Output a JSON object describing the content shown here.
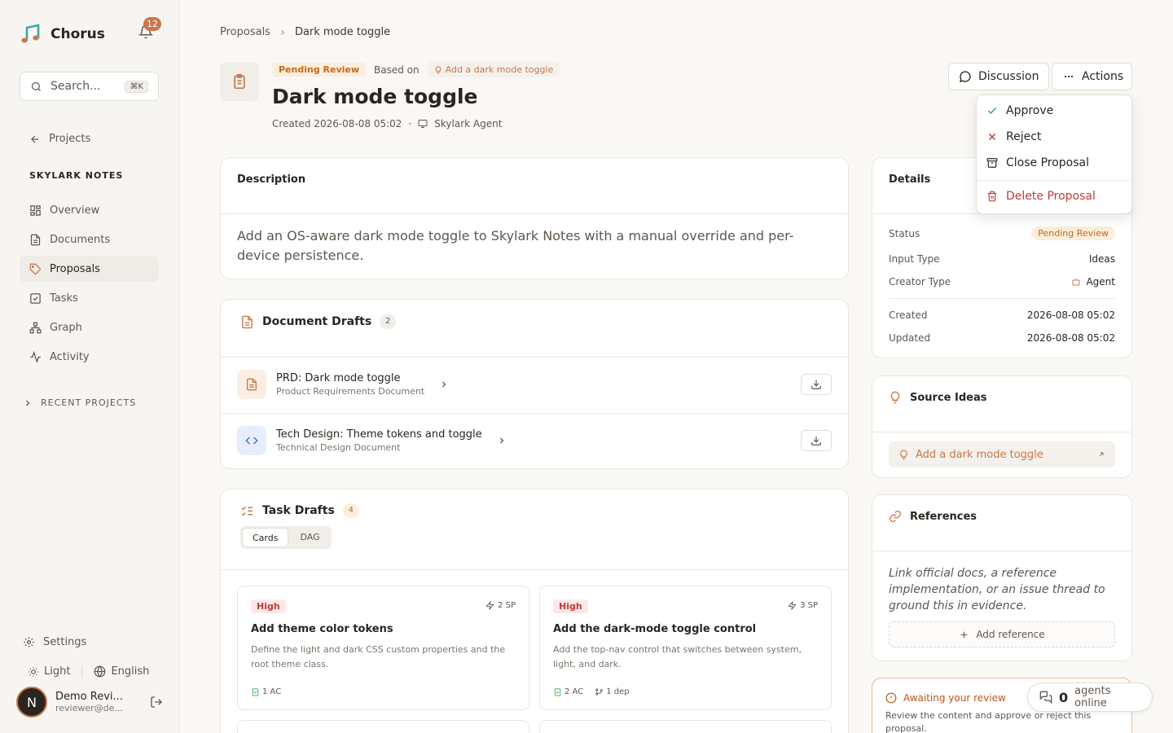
{
  "app": {
    "name": "Chorus",
    "notification_count": "12"
  },
  "search": {
    "placeholder": "Search...",
    "shortcut": "⌘K"
  },
  "sidebar": {
    "back_label": "Projects",
    "project_name": "SKYLARK NOTES",
    "items": [
      {
        "label": "Overview",
        "icon": "grid-icon"
      },
      {
        "label": "Documents",
        "icon": "document-icon"
      },
      {
        "label": "Proposals",
        "icon": "tag-icon",
        "active": true
      },
      {
        "label": "Tasks",
        "icon": "checkbox-icon"
      },
      {
        "label": "Graph",
        "icon": "graph-icon"
      },
      {
        "label": "Activity",
        "icon": "activity-icon"
      }
    ],
    "recent_label": "RECENT PROJECTS",
    "settings_label": "Settings",
    "theme_label": "Light",
    "language_label": "English",
    "user": {
      "initial": "N",
      "name": "Demo Revi...",
      "email": "reviewer@de..."
    }
  },
  "breadcrumb": {
    "parent": "Proposals",
    "current": "Dark mode toggle"
  },
  "proposal": {
    "status": "Pending Review",
    "based_on_label": "Based on",
    "idea_chip": "Add a dark mode toggle",
    "title": "Dark mode toggle",
    "created": "Created 2026-08-08 05:02",
    "agent": "Skylark Agent"
  },
  "buttons": {
    "discussion": "Discussion",
    "actions": "Actions"
  },
  "actions_menu": {
    "approve": "Approve",
    "reject": "Reject",
    "close": "Close Proposal",
    "delete": "Delete Proposal"
  },
  "description": {
    "title": "Description",
    "text": "Add an OS-aware dark mode toggle to Skylark Notes with a manual override and per-device persistence."
  },
  "document_drafts": {
    "title": "Document Drafts",
    "count": "2",
    "items": [
      {
        "title": "PRD: Dark mode toggle",
        "subtitle": "Product Requirements Document"
      },
      {
        "title": "Tech Design: Theme tokens and toggle",
        "subtitle": "Technical Design Document"
      }
    ]
  },
  "task_drafts": {
    "title": "Task Drafts",
    "count": "4",
    "tabs": [
      "Cards",
      "DAG"
    ],
    "cards": [
      {
        "priority": "High",
        "sp": "2 SP",
        "title": "Add theme color tokens",
        "desc": "Define the light and dark CSS custom properties and the root theme class.",
        "ac": "1 AC",
        "dep": ""
      },
      {
        "priority": "High",
        "sp": "3 SP",
        "title": "Add the dark-mode toggle control",
        "desc": "Add the top-nav control that switches between system, light, and dark.",
        "ac": "2 AC",
        "dep": "1 dep"
      }
    ]
  },
  "details": {
    "title": "Details",
    "status_label": "Status",
    "status_value": "Pending Review",
    "input_type_label": "Input Type",
    "input_type_value": "Ideas",
    "creator_type_label": "Creator Type",
    "creator_type_value": "Agent",
    "created_label": "Created",
    "created_value": "2026-08-08 05:02",
    "updated_label": "Updated",
    "updated_value": "2026-08-08 05:02"
  },
  "source_ideas": {
    "title": "Source Ideas",
    "item": "Add a dark mode toggle"
  },
  "references": {
    "title": "References",
    "empty_text": "Link official docs, a reference implementation, or an issue thread to ground this in evidence.",
    "add_label": "Add reference"
  },
  "awaiting": {
    "title": "Awaiting your review",
    "text": "Review the content and approve or reject this proposal."
  },
  "online": {
    "count": "0",
    "label": "agents online"
  },
  "colors": {
    "accent": "#c8784a",
    "pending": "#c26a1a",
    "danger": "#c23a3a"
  }
}
